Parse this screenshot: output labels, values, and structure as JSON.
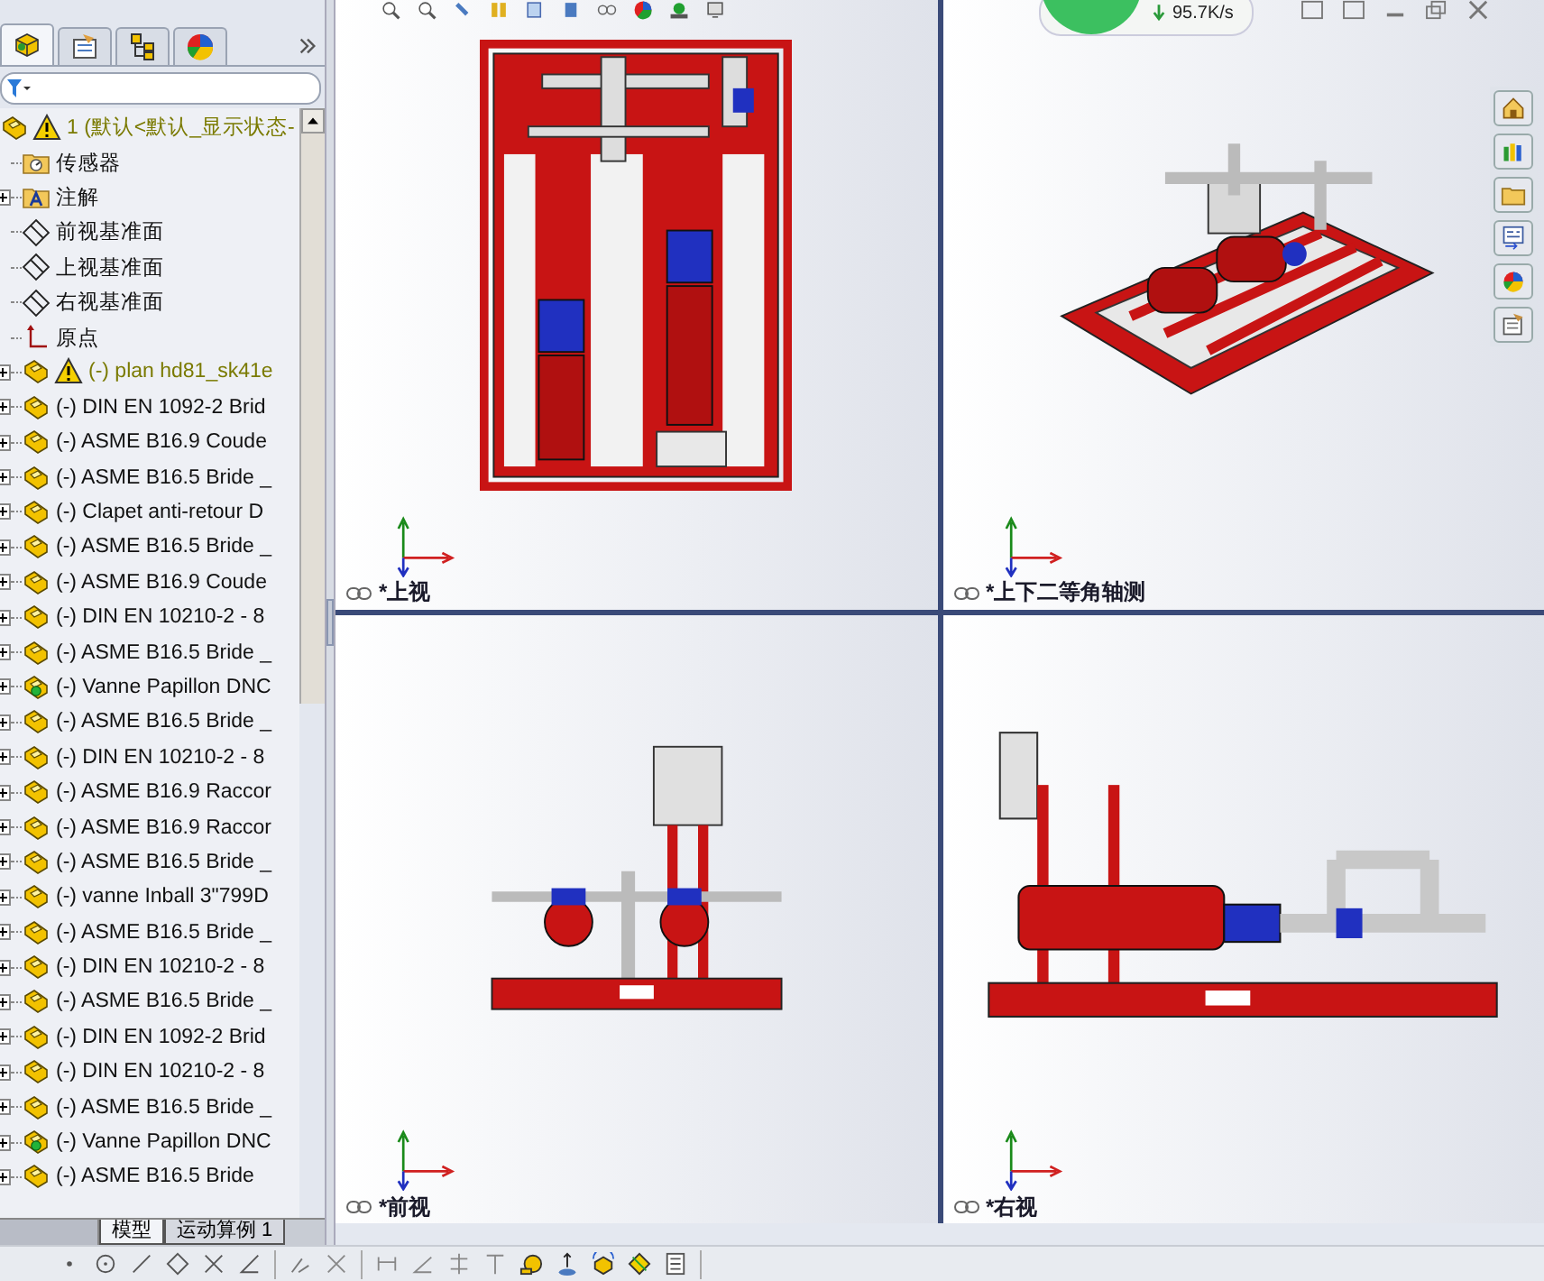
{
  "panel_tabs": [
    {
      "kind": "feature",
      "selected": true
    },
    {
      "kind": "property",
      "selected": false
    },
    {
      "kind": "config",
      "selected": false
    },
    {
      "kind": "display",
      "selected": false
    }
  ],
  "tree": {
    "root": {
      "label": "1 (默认<默认_显示状态-",
      "warning": true
    },
    "items": [
      {
        "kind": "sensor",
        "label": "传感器",
        "expandable": false,
        "warning": false
      },
      {
        "kind": "annotation",
        "label": "注解",
        "expandable": true,
        "warning": false
      },
      {
        "kind": "plane",
        "label": "前视基准面",
        "expandable": false,
        "warning": false
      },
      {
        "kind": "plane",
        "label": "上视基准面",
        "expandable": false,
        "warning": false
      },
      {
        "kind": "plane",
        "label": "右视基准面",
        "expandable": false,
        "warning": false
      },
      {
        "kind": "origin",
        "label": "原点",
        "expandable": false,
        "warning": false
      },
      {
        "kind": "part",
        "label": "(-) plan hd81_sk41e",
        "expandable": true,
        "warning": true
      },
      {
        "kind": "part",
        "label": "(-) DIN EN 1092-2 Brid",
        "expandable": true,
        "warning": false
      },
      {
        "kind": "part",
        "label": "(-) ASME B16.9 Coude",
        "expandable": true,
        "warning": false
      },
      {
        "kind": "part",
        "label": "(-) ASME B16.5 Bride _",
        "expandable": true,
        "warning": false
      },
      {
        "kind": "part",
        "label": "(-) Clapet anti-retour D",
        "expandable": true,
        "warning": false
      },
      {
        "kind": "part",
        "label": "(-) ASME B16.5 Bride _",
        "expandable": true,
        "warning": false
      },
      {
        "kind": "part",
        "label": "(-) ASME B16.9 Coude",
        "expandable": true,
        "warning": false
      },
      {
        "kind": "part",
        "label": "(-) DIN EN 10210-2 - 8",
        "expandable": true,
        "warning": false
      },
      {
        "kind": "part",
        "label": "(-) ASME B16.5 Bride _",
        "expandable": true,
        "warning": false
      },
      {
        "kind": "subassembly",
        "label": "(-) Vanne Papillon DNC",
        "expandable": true,
        "warning": false
      },
      {
        "kind": "part",
        "label": "(-) ASME B16.5 Bride _",
        "expandable": true,
        "warning": false
      },
      {
        "kind": "part",
        "label": "(-) DIN EN 10210-2 - 8",
        "expandable": true,
        "warning": false
      },
      {
        "kind": "part",
        "label": "(-) ASME B16.9 Raccor",
        "expandable": true,
        "warning": false
      },
      {
        "kind": "part",
        "label": "(-) ASME B16.9 Raccor",
        "expandable": true,
        "warning": false
      },
      {
        "kind": "part",
        "label": "(-) ASME B16.5 Bride _",
        "expandable": true,
        "warning": false
      },
      {
        "kind": "part",
        "label": "(-) vanne Inball 3\"799D",
        "expandable": true,
        "warning": false
      },
      {
        "kind": "part",
        "label": "(-) ASME B16.5 Bride _",
        "expandable": true,
        "warning": false
      },
      {
        "kind": "part",
        "label": "(-) DIN EN 10210-2 - 8",
        "expandable": true,
        "warning": false
      },
      {
        "kind": "part",
        "label": "(-) ASME B16.5 Bride _",
        "expandable": true,
        "warning": false
      },
      {
        "kind": "part",
        "label": "(-) DIN EN 1092-2 Brid",
        "expandable": true,
        "warning": false
      },
      {
        "kind": "part",
        "label": "(-) DIN EN 10210-2 - 8",
        "expandable": true,
        "warning": false
      },
      {
        "kind": "part",
        "label": "(-) ASME B16.5 Bride _",
        "expandable": true,
        "warning": false
      },
      {
        "kind": "subassembly",
        "label": "(-) Vanne Papillon DNC",
        "expandable": true,
        "warning": false
      },
      {
        "kind": "part",
        "label": "(-) ASME B16.5 Bride",
        "expandable": true,
        "warning": false
      }
    ]
  },
  "bottom_tabs": [
    {
      "label": "模型",
      "selected": true
    },
    {
      "label": "运动算例 1",
      "selected": false
    }
  ],
  "viewports": [
    {
      "kind": "top",
      "label": "*上视"
    },
    {
      "kind": "dimetric",
      "label": "*上下二等角轴测"
    },
    {
      "kind": "front",
      "label": "*前视"
    },
    {
      "kind": "right",
      "label": "*右视"
    }
  ],
  "net_speed": {
    "speed": "95.7K/s"
  }
}
